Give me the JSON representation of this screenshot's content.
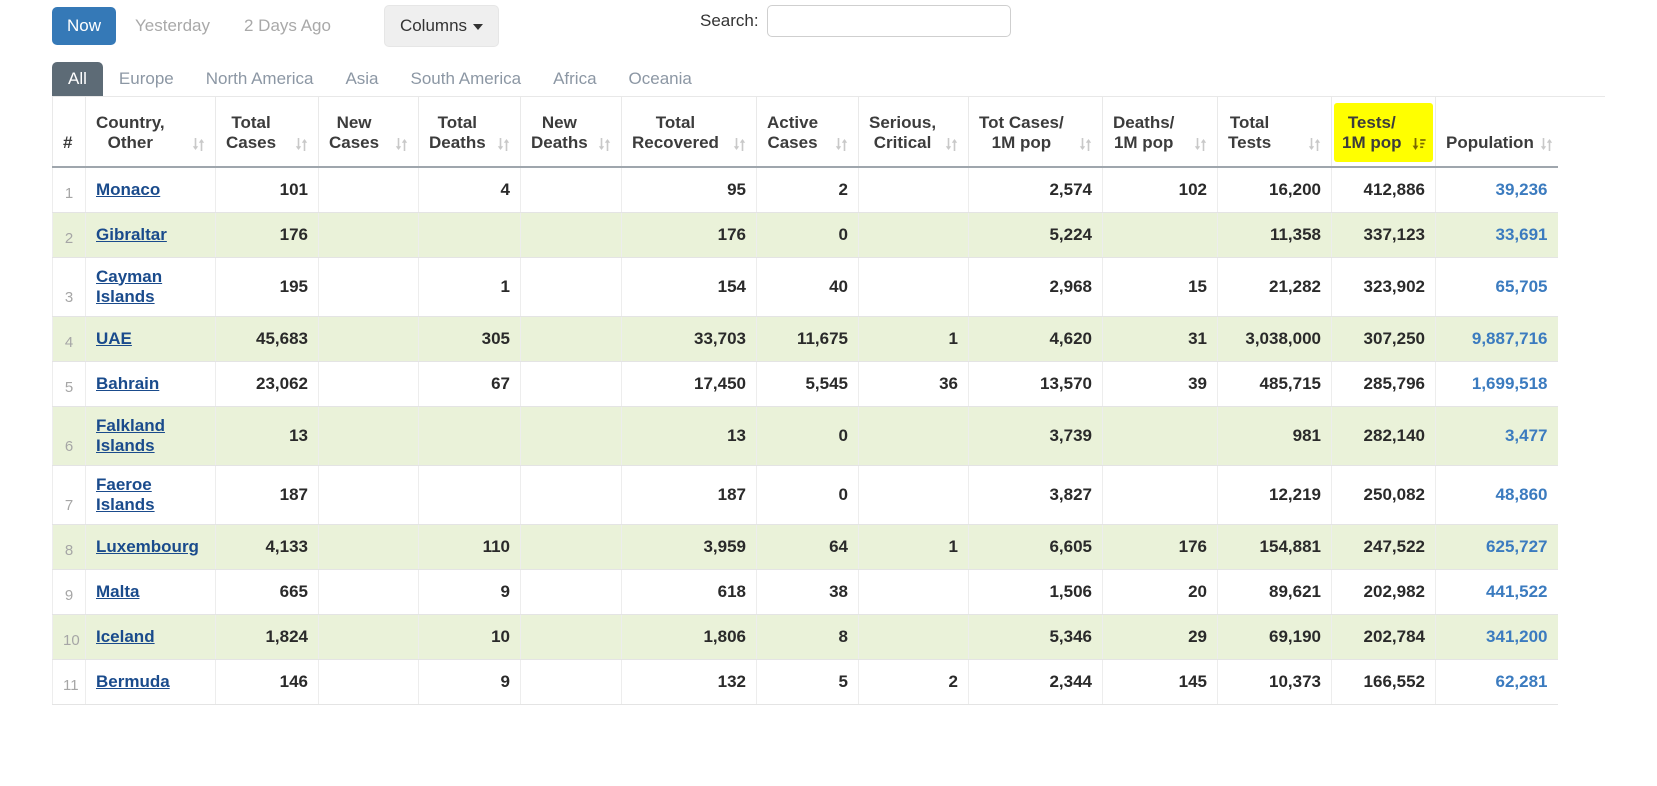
{
  "toolbar": {
    "day_buttons": [
      {
        "label": "Now",
        "active": true
      },
      {
        "label": "Yesterday",
        "active": false
      },
      {
        "label": "2 Days Ago",
        "active": false
      }
    ],
    "columns_button": "Columns",
    "search_label": "Search:",
    "search_value": "",
    "search_placeholder": ""
  },
  "tabs": [
    {
      "label": "All",
      "active": true
    },
    {
      "label": "Europe",
      "active": false
    },
    {
      "label": "North America",
      "active": false
    },
    {
      "label": "Asia",
      "active": false
    },
    {
      "label": "South America",
      "active": false
    },
    {
      "label": "Africa",
      "active": false
    },
    {
      "label": "Oceania",
      "active": false
    }
  ],
  "table": {
    "columns": [
      {
        "key": "idx",
        "label": "#",
        "line2": "",
        "sortable": false,
        "sorted": "none"
      },
      {
        "key": "name",
        "label": "Country,",
        "line2": "Other",
        "sortable": true,
        "sorted": "none"
      },
      {
        "key": "tc",
        "label": "Total",
        "line2": "Cases",
        "sortable": true,
        "sorted": "none"
      },
      {
        "key": "nc",
        "label": "New",
        "line2": "Cases",
        "sortable": true,
        "sorted": "none"
      },
      {
        "key": "td",
        "label": "Total",
        "line2": "Deaths",
        "sortable": true,
        "sorted": "none"
      },
      {
        "key": "nd",
        "label": "New",
        "line2": "Deaths",
        "sortable": true,
        "sorted": "none"
      },
      {
        "key": "tr",
        "label": "Total",
        "line2": "Recovered",
        "sortable": true,
        "sorted": "none"
      },
      {
        "key": "ac",
        "label": "Active",
        "line2": "Cases",
        "sortable": true,
        "sorted": "none"
      },
      {
        "key": "sc",
        "label": "Serious,",
        "line2": "Critical",
        "sortable": true,
        "sorted": "none"
      },
      {
        "key": "tcp",
        "label": "Tot Cases/",
        "line2": "1M pop",
        "sortable": true,
        "sorted": "none"
      },
      {
        "key": "dp",
        "label": "Deaths/",
        "line2": "1M pop",
        "sortable": true,
        "sorted": "none"
      },
      {
        "key": "tt",
        "label": "Total",
        "line2": "Tests",
        "sortable": true,
        "sorted": "none"
      },
      {
        "key": "ttp",
        "label": "Tests/",
        "line2": "1M pop",
        "sortable": true,
        "sorted": "desc",
        "highlight": true
      },
      {
        "key": "pop",
        "label": "Population",
        "line2": "",
        "sortable": true,
        "sorted": "none"
      }
    ],
    "rows": [
      {
        "idx": "1",
        "name": "Monaco",
        "tc": "101",
        "nc": "",
        "td": "4",
        "nd": "",
        "tr": "95",
        "ac": "2",
        "sc": "",
        "tcp": "2,574",
        "dp": "102",
        "tt": "16,200",
        "ttp": "412,886",
        "pop": "39,236"
      },
      {
        "idx": "2",
        "name": "Gibraltar",
        "tc": "176",
        "nc": "",
        "td": "",
        "nd": "",
        "tr": "176",
        "ac": "0",
        "sc": "",
        "tcp": "5,224",
        "dp": "",
        "tt": "11,358",
        "ttp": "337,123",
        "pop": "33,691"
      },
      {
        "idx": "3",
        "name": "Cayman Islands",
        "tc": "195",
        "nc": "",
        "td": "1",
        "nd": "",
        "tr": "154",
        "ac": "40",
        "sc": "",
        "tcp": "2,968",
        "dp": "15",
        "tt": "21,282",
        "ttp": "323,902",
        "pop": "65,705"
      },
      {
        "idx": "4",
        "name": "UAE",
        "tc": "45,683",
        "nc": "",
        "td": "305",
        "nd": "",
        "tr": "33,703",
        "ac": "11,675",
        "sc": "1",
        "tcp": "4,620",
        "dp": "31",
        "tt": "3,038,000",
        "ttp": "307,250",
        "pop": "9,887,716"
      },
      {
        "idx": "5",
        "name": "Bahrain",
        "tc": "23,062",
        "nc": "",
        "td": "67",
        "nd": "",
        "tr": "17,450",
        "ac": "5,545",
        "sc": "36",
        "tcp": "13,570",
        "dp": "39",
        "tt": "485,715",
        "ttp": "285,796",
        "pop": "1,699,518"
      },
      {
        "idx": "6",
        "name": "Falkland Islands",
        "tc": "13",
        "nc": "",
        "td": "",
        "nd": "",
        "tr": "13",
        "ac": "0",
        "sc": "",
        "tcp": "3,739",
        "dp": "",
        "tt": "981",
        "ttp": "282,140",
        "pop": "3,477"
      },
      {
        "idx": "7",
        "name": "Faeroe Islands",
        "tc": "187",
        "nc": "",
        "td": "",
        "nd": "",
        "tr": "187",
        "ac": "0",
        "sc": "",
        "tcp": "3,827",
        "dp": "",
        "tt": "12,219",
        "ttp": "250,082",
        "pop": "48,860"
      },
      {
        "idx": "8",
        "name": "Luxembourg",
        "tc": "4,133",
        "nc": "",
        "td": "110",
        "nd": "",
        "tr": "3,959",
        "ac": "64",
        "sc": "1",
        "tcp": "6,605",
        "dp": "176",
        "tt": "154,881",
        "ttp": "247,522",
        "pop": "625,727"
      },
      {
        "idx": "9",
        "name": "Malta",
        "tc": "665",
        "nc": "",
        "td": "9",
        "nd": "",
        "tr": "618",
        "ac": "38",
        "sc": "",
        "tcp": "1,506",
        "dp": "20",
        "tt": "89,621",
        "ttp": "202,982",
        "pop": "441,522"
      },
      {
        "idx": "10",
        "name": "Iceland",
        "tc": "1,824",
        "nc": "",
        "td": "10",
        "nd": "",
        "tr": "1,806",
        "ac": "8",
        "sc": "",
        "tcp": "5,346",
        "dp": "29",
        "tt": "69,190",
        "ttp": "202,784",
        "pop": "341,200"
      },
      {
        "idx": "11",
        "name": "Bermuda",
        "tc": "146",
        "nc": "",
        "td": "9",
        "nd": "",
        "tr": "132",
        "ac": "5",
        "sc": "2",
        "tcp": "2,344",
        "dp": "145",
        "tt": "10,373",
        "ttp": "166,552",
        "pop": "62,281"
      }
    ]
  },
  "colors": {
    "accent_blue": "#3579b7",
    "tab_active": "#5d6b76",
    "link_blue": "#1a4b8c",
    "population_blue": "#3b7bbf",
    "alt_row": "#eaf2d9",
    "highlight_yellow": "#ffff00"
  }
}
